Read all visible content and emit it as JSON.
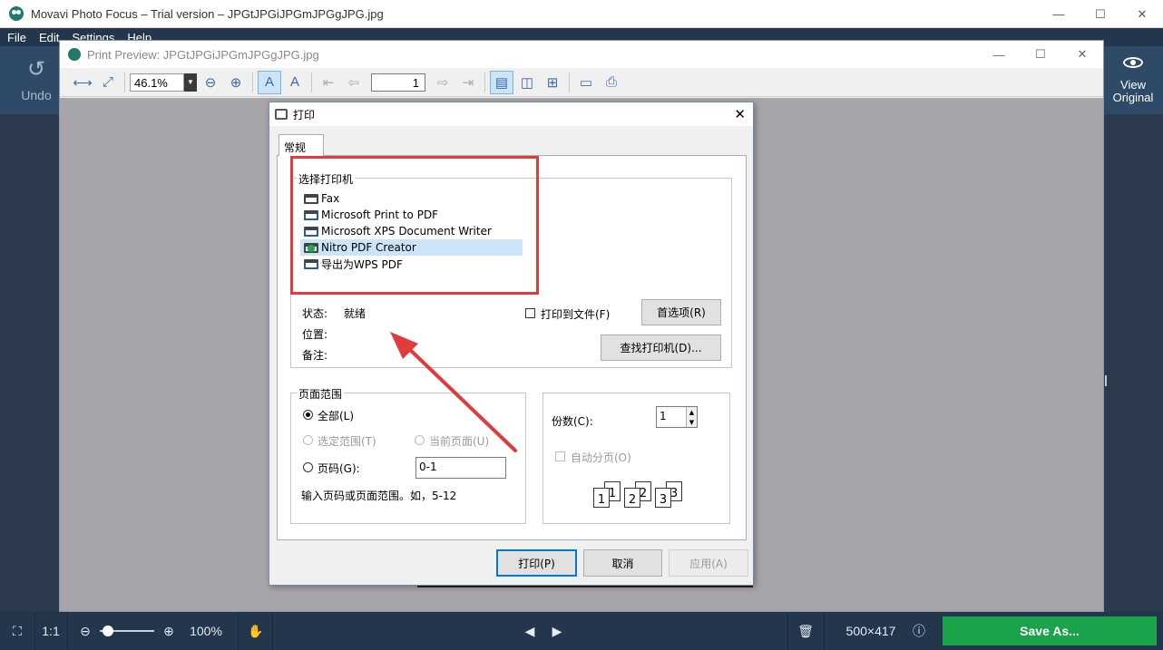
{
  "app": {
    "title": "Movavi Photo Focus – Trial version – JPGtJPGiJPGmJPGgJPG.jpg",
    "minimize": "—",
    "maximize": "☐",
    "close": "✕"
  },
  "menu": [
    "File",
    "Edit",
    "Settings",
    "Help"
  ],
  "left_panel": {
    "undo_label": "Undo",
    "undo_icon": "↺"
  },
  "right_panel": {
    "view_label_line1": "View",
    "view_label_line2": "Original"
  },
  "print_preview": {
    "title": "Print Preview: JPGtJPGiJPGmJPGgJPG.jpg",
    "zoom_value": "46.1%",
    "page_number": "1"
  },
  "print_dialog": {
    "title": "打印",
    "tab_label": "常规",
    "select_printer_legend": "选择打印机",
    "printers": [
      {
        "name": "Fax",
        "icon": "fax-printer-icon"
      },
      {
        "name": "Microsoft Print to PDF",
        "icon": "printer-icon"
      },
      {
        "name": "Microsoft XPS Document Writer",
        "icon": "printer-icon"
      },
      {
        "name": "Nitro PDF Creator",
        "icon": "default-printer-icon"
      },
      {
        "name": "导出为WPS PDF",
        "icon": "printer-icon"
      }
    ],
    "status_label": "状态:",
    "status_value": "就绪",
    "location_label": "位置:",
    "comment_label": "备注:",
    "print_to_file": "打印到文件(F)",
    "preferences_button": "首选项(R)",
    "find_printer_button": "查找打印机(D)...",
    "page_range_legend": "页面范围",
    "range_all": "全部(L)",
    "range_selection": "选定范围(T)",
    "range_current": "当前页面(U)",
    "range_pages": "页码(G):",
    "range_pages_value": "0-1",
    "range_hint": "输入页码或页面范围。如，5-12",
    "copies_label": "份数(C):",
    "copies_value": "1",
    "collate_label": "自动分页(O)",
    "collate_pages": [
      "1",
      "1",
      "2",
      "2",
      "3",
      "3"
    ],
    "print_button": "打印(P)",
    "cancel_button": "取消",
    "apply_button": "应用(A)"
  },
  "bottom_bar": {
    "ratio_label": "1:1",
    "zoom_percent": "100%",
    "image_size": "500×417",
    "save_label": "Save As..."
  },
  "colors": {
    "app_dark": "#23364c",
    "save_green": "#1aa34a",
    "highlight_red": "#e23b3b"
  }
}
